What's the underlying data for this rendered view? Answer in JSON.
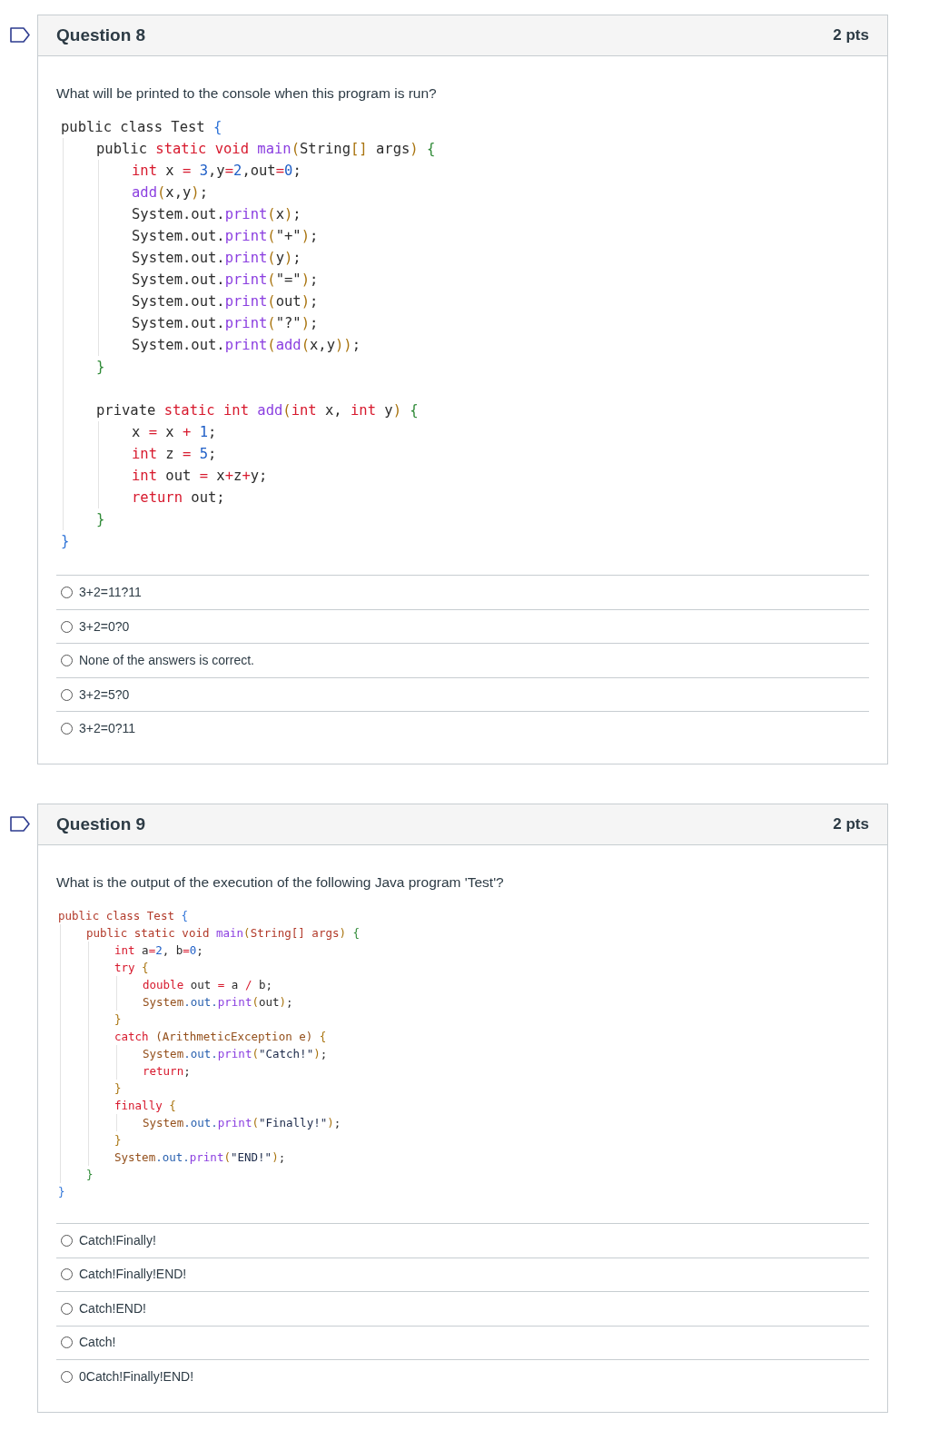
{
  "questions": [
    {
      "title": "Question 8",
      "points": "2 pts",
      "flagged": false,
      "prompt": "What will be printed to the console when this program is run?",
      "code": {
        "kind": "large",
        "items": [
          {
            "kind": "line",
            "tokens": [
              {
                "text": "public class Test ",
                "kind": "p"
              },
              {
                "text": "{",
                "kind": "c"
              }
            ]
          },
          {
            "kind": "block",
            "children": [
              {
                "kind": "line",
                "tokens": [
                  {
                    "text": "public ",
                    "kind": "p"
                  },
                  {
                    "text": "static void ",
                    "kind": "k"
                  },
                  {
                    "text": "main",
                    "kind": "f"
                  },
                  {
                    "text": "(",
                    "kind": "y"
                  },
                  {
                    "text": "String",
                    "kind": "p"
                  },
                  {
                    "text": "[]",
                    "kind": "y"
                  },
                  {
                    "text": " args",
                    "kind": "p"
                  },
                  {
                    "text": ")",
                    "kind": "y"
                  },
                  {
                    "text": " {",
                    "kind": "b"
                  }
                ]
              },
              {
                "kind": "block",
                "children": [
                  {
                    "kind": "line",
                    "tokens": [
                      {
                        "text": "int",
                        "kind": "k"
                      },
                      {
                        "text": " x ",
                        "kind": "p"
                      },
                      {
                        "text": "=",
                        "kind": "o"
                      },
                      {
                        "text": " 3",
                        "kind": "n"
                      },
                      {
                        "text": ",y",
                        "kind": "p"
                      },
                      {
                        "text": "=",
                        "kind": "o"
                      },
                      {
                        "text": "2",
                        "kind": "n"
                      },
                      {
                        "text": ",out",
                        "kind": "p"
                      },
                      {
                        "text": "=",
                        "kind": "o"
                      },
                      {
                        "text": "0",
                        "kind": "n"
                      },
                      {
                        "text": ";",
                        "kind": "p"
                      }
                    ]
                  },
                  {
                    "kind": "line",
                    "tokens": [
                      {
                        "text": "add",
                        "kind": "f"
                      },
                      {
                        "text": "(",
                        "kind": "y"
                      },
                      {
                        "text": "x,y",
                        "kind": "p"
                      },
                      {
                        "text": ")",
                        "kind": "y"
                      },
                      {
                        "text": ";",
                        "kind": "p"
                      }
                    ]
                  },
                  {
                    "kind": "line",
                    "tokens": [
                      {
                        "text": "System.out.",
                        "kind": "p"
                      },
                      {
                        "text": "print",
                        "kind": "f"
                      },
                      {
                        "text": "(",
                        "kind": "y"
                      },
                      {
                        "text": "x",
                        "kind": "p"
                      },
                      {
                        "text": ")",
                        "kind": "y"
                      },
                      {
                        "text": ";",
                        "kind": "p"
                      }
                    ]
                  },
                  {
                    "kind": "line",
                    "tokens": [
                      {
                        "text": "System.out.",
                        "kind": "p"
                      },
                      {
                        "text": "print",
                        "kind": "f"
                      },
                      {
                        "text": "(",
                        "kind": "y"
                      },
                      {
                        "text": "\"+\"",
                        "kind": "p"
                      },
                      {
                        "text": ")",
                        "kind": "y"
                      },
                      {
                        "text": ";",
                        "kind": "p"
                      }
                    ]
                  },
                  {
                    "kind": "line",
                    "tokens": [
                      {
                        "text": "System.out.",
                        "kind": "p"
                      },
                      {
                        "text": "print",
                        "kind": "f"
                      },
                      {
                        "text": "(",
                        "kind": "y"
                      },
                      {
                        "text": "y",
                        "kind": "p"
                      },
                      {
                        "text": ")",
                        "kind": "y"
                      },
                      {
                        "text": ";",
                        "kind": "p"
                      }
                    ]
                  },
                  {
                    "kind": "line",
                    "tokens": [
                      {
                        "text": "System.out.",
                        "kind": "p"
                      },
                      {
                        "text": "print",
                        "kind": "f"
                      },
                      {
                        "text": "(",
                        "kind": "y"
                      },
                      {
                        "text": "\"=\"",
                        "kind": "p"
                      },
                      {
                        "text": ")",
                        "kind": "y"
                      },
                      {
                        "text": ";",
                        "kind": "p"
                      }
                    ]
                  },
                  {
                    "kind": "line",
                    "tokens": [
                      {
                        "text": "System.out.",
                        "kind": "p"
                      },
                      {
                        "text": "print",
                        "kind": "f"
                      },
                      {
                        "text": "(",
                        "kind": "y"
                      },
                      {
                        "text": "out",
                        "kind": "p"
                      },
                      {
                        "text": ")",
                        "kind": "y"
                      },
                      {
                        "text": ";",
                        "kind": "p"
                      }
                    ]
                  },
                  {
                    "kind": "line",
                    "tokens": [
                      {
                        "text": "System.out.",
                        "kind": "p"
                      },
                      {
                        "text": "print",
                        "kind": "f"
                      },
                      {
                        "text": "(",
                        "kind": "y"
                      },
                      {
                        "text": "\"?\"",
                        "kind": "p"
                      },
                      {
                        "text": ")",
                        "kind": "y"
                      },
                      {
                        "text": ";",
                        "kind": "p"
                      }
                    ]
                  },
                  {
                    "kind": "line",
                    "tokens": [
                      {
                        "text": "System.out.",
                        "kind": "p"
                      },
                      {
                        "text": "print",
                        "kind": "f"
                      },
                      {
                        "text": "(",
                        "kind": "y"
                      },
                      {
                        "text": "add",
                        "kind": "f"
                      },
                      {
                        "text": "(",
                        "kind": "y"
                      },
                      {
                        "text": "x,y",
                        "kind": "p"
                      },
                      {
                        "text": "))",
                        "kind": "y"
                      },
                      {
                        "text": ";",
                        "kind": "p"
                      }
                    ]
                  }
                ]
              },
              {
                "kind": "line",
                "tokens": [
                  {
                    "text": "}",
                    "kind": "b"
                  }
                ]
              },
              {
                "kind": "blank"
              },
              {
                "kind": "line",
                "tokens": [
                  {
                    "text": "private ",
                    "kind": "p"
                  },
                  {
                    "text": "static int ",
                    "kind": "k"
                  },
                  {
                    "text": "add",
                    "kind": "f"
                  },
                  {
                    "text": "(",
                    "kind": "y"
                  },
                  {
                    "text": "int",
                    "kind": "k"
                  },
                  {
                    "text": " x, ",
                    "kind": "p"
                  },
                  {
                    "text": "int",
                    "kind": "k"
                  },
                  {
                    "text": " y",
                    "kind": "p"
                  },
                  {
                    "text": ")",
                    "kind": "y"
                  },
                  {
                    "text": " {",
                    "kind": "b"
                  }
                ]
              },
              {
                "kind": "block",
                "children": [
                  {
                    "kind": "line",
                    "tokens": [
                      {
                        "text": "x ",
                        "kind": "p"
                      },
                      {
                        "text": "=",
                        "kind": "o"
                      },
                      {
                        "text": " x ",
                        "kind": "p"
                      },
                      {
                        "text": "+",
                        "kind": "o"
                      },
                      {
                        "text": " 1",
                        "kind": "n"
                      },
                      {
                        "text": ";",
                        "kind": "p"
                      }
                    ]
                  },
                  {
                    "kind": "line",
                    "tokens": [
                      {
                        "text": "int",
                        "kind": "k"
                      },
                      {
                        "text": " z ",
                        "kind": "p"
                      },
                      {
                        "text": "=",
                        "kind": "o"
                      },
                      {
                        "text": " 5",
                        "kind": "n"
                      },
                      {
                        "text": ";",
                        "kind": "p"
                      }
                    ]
                  },
                  {
                    "kind": "line",
                    "tokens": [
                      {
                        "text": "int",
                        "kind": "k"
                      },
                      {
                        "text": " out ",
                        "kind": "p"
                      },
                      {
                        "text": "=",
                        "kind": "o"
                      },
                      {
                        "text": " x",
                        "kind": "p"
                      },
                      {
                        "text": "+",
                        "kind": "o"
                      },
                      {
                        "text": "z",
                        "kind": "p"
                      },
                      {
                        "text": "+",
                        "kind": "o"
                      },
                      {
                        "text": "y;",
                        "kind": "p"
                      }
                    ]
                  },
                  {
                    "kind": "line",
                    "tokens": [
                      {
                        "text": "return",
                        "kind": "k"
                      },
                      {
                        "text": " out;",
                        "kind": "p"
                      }
                    ]
                  }
                ]
              },
              {
                "kind": "line",
                "tokens": [
                  {
                    "text": "}",
                    "kind": "b"
                  }
                ]
              }
            ]
          },
          {
            "kind": "line",
            "tokens": [
              {
                "text": "}",
                "kind": "c"
              }
            ]
          }
        ]
      },
      "answers": [
        {
          "label": "3+2=11?11",
          "selected": false
        },
        {
          "label": "3+2=0?0",
          "selected": false
        },
        {
          "label": "None of the answers is correct.",
          "selected": false
        },
        {
          "label": "3+2=5?0",
          "selected": false
        },
        {
          "label": "3+2=0?11",
          "selected": false
        }
      ]
    },
    {
      "title": "Question 9",
      "points": "2 pts",
      "flagged": false,
      "prompt": "What is the output of the execution of the following Java program 'Test'?",
      "code": {
        "kind": "compact",
        "items": [
          {
            "kind": "line",
            "tokens": [
              {
                "text": "public class Test ",
                "kind": "d"
              },
              {
                "text": "{",
                "kind": "c"
              }
            ]
          },
          {
            "kind": "block",
            "children": [
              {
                "kind": "line",
                "tokens": [
                  {
                    "text": "public static void ",
                    "kind": "d"
                  },
                  {
                    "text": "main",
                    "kind": "f"
                  },
                  {
                    "text": "(",
                    "kind": "y"
                  },
                  {
                    "text": "String[] args",
                    "kind": "d"
                  },
                  {
                    "text": ")",
                    "kind": "y"
                  },
                  {
                    "text": " {",
                    "kind": "b"
                  }
                ]
              },
              {
                "kind": "block",
                "children": [
                  {
                    "kind": "line",
                    "tokens": [
                      {
                        "text": "int",
                        "kind": "k"
                      },
                      {
                        "text": " a",
                        "kind": "p"
                      },
                      {
                        "text": "=",
                        "kind": "o"
                      },
                      {
                        "text": "2",
                        "kind": "n"
                      },
                      {
                        "text": ", b",
                        "kind": "p"
                      },
                      {
                        "text": "=",
                        "kind": "o"
                      },
                      {
                        "text": "0",
                        "kind": "n"
                      },
                      {
                        "text": ";",
                        "kind": "p"
                      }
                    ]
                  },
                  {
                    "kind": "line",
                    "tokens": [
                      {
                        "text": "try",
                        "kind": "k"
                      },
                      {
                        "text": " {",
                        "kind": "y"
                      }
                    ]
                  },
                  {
                    "kind": "block",
                    "children": [
                      {
                        "kind": "line",
                        "tokens": [
                          {
                            "text": "double",
                            "kind": "k"
                          },
                          {
                            "text": " out ",
                            "kind": "p"
                          },
                          {
                            "text": "=",
                            "kind": "o"
                          },
                          {
                            "text": " a ",
                            "kind": "p"
                          },
                          {
                            "text": "/",
                            "kind": "o"
                          },
                          {
                            "text": " b;",
                            "kind": "p"
                          }
                        ]
                      },
                      {
                        "kind": "line",
                        "tokens": [
                          {
                            "text": "System",
                            "kind": "s"
                          },
                          {
                            "text": ".out.",
                            "kind": "u"
                          },
                          {
                            "text": "print",
                            "kind": "f"
                          },
                          {
                            "text": "(",
                            "kind": "y"
                          },
                          {
                            "text": "out",
                            "kind": "p"
                          },
                          {
                            "text": ")",
                            "kind": "y"
                          },
                          {
                            "text": ";",
                            "kind": "p"
                          }
                        ]
                      }
                    ]
                  },
                  {
                    "kind": "line",
                    "tokens": [
                      {
                        "text": "}",
                        "kind": "y"
                      }
                    ]
                  },
                  {
                    "kind": "line",
                    "tokens": [
                      {
                        "text": "catch",
                        "kind": "k"
                      },
                      {
                        "text": " (ArithmeticException e) ",
                        "kind": "s"
                      },
                      {
                        "text": "{",
                        "kind": "y"
                      }
                    ]
                  },
                  {
                    "kind": "block",
                    "children": [
                      {
                        "kind": "line",
                        "tokens": [
                          {
                            "text": "System",
                            "kind": "s"
                          },
                          {
                            "text": ".out.",
                            "kind": "u"
                          },
                          {
                            "text": "print",
                            "kind": "f"
                          },
                          {
                            "text": "(",
                            "kind": "y"
                          },
                          {
                            "text": "\"Catch!\"",
                            "kind": "t"
                          },
                          {
                            "text": ")",
                            "kind": "y"
                          },
                          {
                            "text": ";",
                            "kind": "p"
                          }
                        ]
                      },
                      {
                        "kind": "line",
                        "tokens": [
                          {
                            "text": "return",
                            "kind": "k"
                          },
                          {
                            "text": ";",
                            "kind": "p"
                          }
                        ]
                      }
                    ]
                  },
                  {
                    "kind": "line",
                    "tokens": [
                      {
                        "text": "}",
                        "kind": "y"
                      }
                    ]
                  },
                  {
                    "kind": "line",
                    "tokens": [
                      {
                        "text": "finally",
                        "kind": "k"
                      },
                      {
                        "text": " {",
                        "kind": "y"
                      }
                    ]
                  },
                  {
                    "kind": "block",
                    "children": [
                      {
                        "kind": "line",
                        "tokens": [
                          {
                            "text": "System",
                            "kind": "s"
                          },
                          {
                            "text": ".out.",
                            "kind": "u"
                          },
                          {
                            "text": "print",
                            "kind": "f"
                          },
                          {
                            "text": "(",
                            "kind": "y"
                          },
                          {
                            "text": "\"Finally!\"",
                            "kind": "t"
                          },
                          {
                            "text": ")",
                            "kind": "y"
                          },
                          {
                            "text": ";",
                            "kind": "p"
                          }
                        ]
                      }
                    ]
                  },
                  {
                    "kind": "line",
                    "tokens": [
                      {
                        "text": "}",
                        "kind": "y"
                      }
                    ]
                  },
                  {
                    "kind": "line",
                    "tokens": [
                      {
                        "text": "System",
                        "kind": "s"
                      },
                      {
                        "text": ".out.",
                        "kind": "u"
                      },
                      {
                        "text": "print",
                        "kind": "f"
                      },
                      {
                        "text": "(",
                        "kind": "y"
                      },
                      {
                        "text": "\"END!\"",
                        "kind": "t"
                      },
                      {
                        "text": ")",
                        "kind": "y"
                      },
                      {
                        "text": ";",
                        "kind": "p"
                      }
                    ]
                  }
                ]
              },
              {
                "kind": "line",
                "tokens": [
                  {
                    "text": "}",
                    "kind": "b"
                  }
                ]
              }
            ]
          },
          {
            "kind": "line",
            "tokens": [
              {
                "text": "}",
                "kind": "c"
              }
            ]
          }
        ]
      },
      "answers": [
        {
          "label": "Catch!Finally!",
          "selected": false
        },
        {
          "label": "Catch!Finally!END!",
          "selected": false
        },
        {
          "label": "Catch!END!",
          "selected": false
        },
        {
          "label": "Catch!",
          "selected": false
        },
        {
          "label": "0Catch!Finally!END!",
          "selected": false
        }
      ]
    }
  ]
}
